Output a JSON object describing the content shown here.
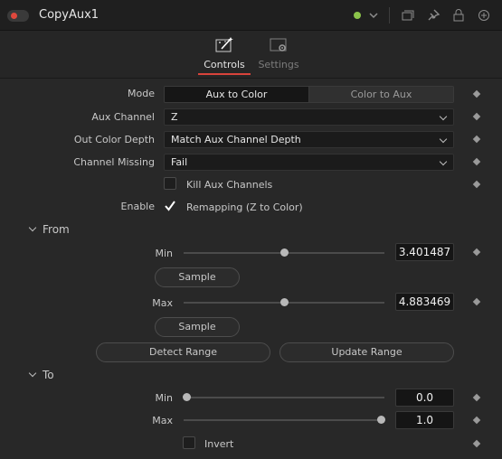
{
  "header": {
    "title": "CopyAux1",
    "status_color": "#8bc34a",
    "icons": [
      "chevron-down-icon",
      "versions-icon",
      "pin-icon",
      "lock-icon",
      "reset-icon"
    ]
  },
  "tabs": [
    {
      "label": "Controls",
      "icon": "wand-icon",
      "active": true
    },
    {
      "label": "Settings",
      "icon": "gear-screen-icon",
      "active": false
    }
  ],
  "accent_color": "#d8433b",
  "mode": {
    "label": "Mode",
    "options": [
      "Aux to Color",
      "Color to Aux"
    ],
    "selected": "Aux to Color"
  },
  "aux_channel": {
    "label": "Aux Channel",
    "value": "Z"
  },
  "out_color_depth": {
    "label": "Out Color Depth",
    "value": "Match Aux Channel Depth"
  },
  "channel_missing": {
    "label": "Channel Missing",
    "value": "Fail"
  },
  "kill_aux": {
    "label": "Kill Aux Channels",
    "checked": false
  },
  "enable": {
    "label": "Enable",
    "check_label": "Remapping (Z to Color)",
    "checked": true
  },
  "from": {
    "heading": "From",
    "min": {
      "label": "Min",
      "value": "3.401487",
      "position": 0.5
    },
    "sample1": "Sample",
    "max": {
      "label": "Max",
      "value": "4.883469",
      "position": 0.5
    },
    "sample2": "Sample",
    "detect_range": "Detect Range",
    "update_range": "Update Range"
  },
  "to": {
    "heading": "To",
    "min": {
      "label": "Min",
      "value": "0.0",
      "position": 0.0
    },
    "max": {
      "label": "Max",
      "value": "1.0",
      "position": 1.0
    },
    "invert": {
      "label": "Invert",
      "checked": false
    }
  }
}
